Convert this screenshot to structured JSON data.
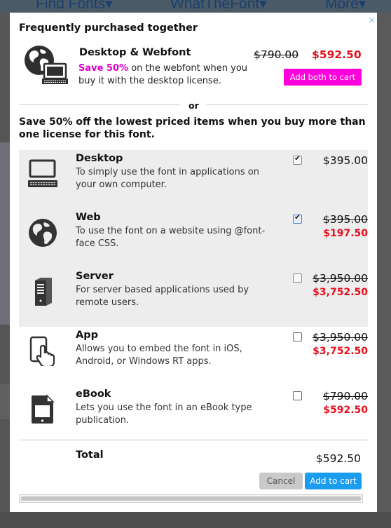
{
  "background": {
    "nav": [
      "Find Fonts",
      "WhatTheFont",
      "More"
    ],
    "nav_arrow": "▾"
  },
  "modal": {
    "close_glyph": "×",
    "title": "Frequently purchased together",
    "bundle": {
      "name": "Desktop & Webfont",
      "highlight": "Save 50%",
      "description": " on the webfont when you buy it with the desktop license.",
      "old_price": "$790.00",
      "new_price": "$592.50",
      "button": "Add both to cart"
    },
    "or_label": "or",
    "intro": "Save 50% off the lowest priced items when you buy more than one license for this font.",
    "options": [
      {
        "icon": "desktop-icon",
        "name": "Desktop",
        "description": "To simply use the font in applications on your own computer.",
        "checked": true,
        "price": "$395.00",
        "sale_price": ""
      },
      {
        "icon": "globe-icon",
        "name": "Web",
        "description": "To use the font on a website using @font-face CSS.",
        "checked": true,
        "price": "$395.00",
        "sale_price": "$197.50"
      },
      {
        "icon": "server-icon",
        "name": "Server",
        "description": "For server based applications used by remote users.",
        "checked": false,
        "price": "$3,950.00",
        "sale_price": "$3,752.50"
      },
      {
        "icon": "app-icon",
        "name": "App",
        "description": "Allows you to embed the font in iOS, Android, or Windows RT apps.",
        "checked": false,
        "price": "$3,950.00",
        "sale_price": "$3,752.50"
      },
      {
        "icon": "ebook-icon",
        "name": "eBook",
        "description": "Lets you use the font in an eBook type publication.",
        "checked": false,
        "price": "$790.00",
        "sale_price": "$592.50"
      }
    ],
    "total_label": "Total",
    "total_value": "$592.50",
    "cancel_button": "Cancel",
    "add_button": "Add to cart",
    "colors": {
      "accent_pink": "#ff00dd",
      "sale_red": "#e8101c",
      "primary_blue": "#1a9cf0"
    }
  }
}
